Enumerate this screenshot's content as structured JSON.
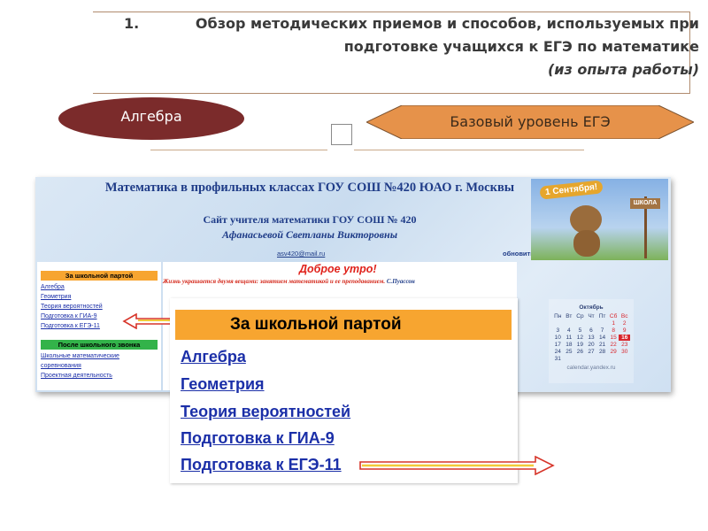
{
  "slide": {
    "title_number": "1.",
    "title_line1": "Обзор методических приемов и способов, используемых при",
    "title_line2": "подготовке учащихся к ЕГЭ по математике",
    "title_line3": "(из опыта работы)",
    "algebra_label": "Алгебра",
    "level_label": "Базовый уровень ЕГЭ",
    "colors": {
      "oval": "#7b2b2b",
      "diamond": "#e6924a",
      "frame_line": "#b08b6e"
    },
    "mid_icon": "square-icon"
  },
  "website": {
    "header_title": "Математика в профильных классах ГОУ СОШ №420 ЮАО г. Москвы",
    "subtitle_line1": "Сайт учителя математики ГОУ СОШ № 420",
    "subtitle_line2": "Афанасьевой Светланы Викторовны",
    "email": "asv420@mail.ru",
    "refresh_link": "обновить страницу",
    "banner_date": "1 Сентября!",
    "banner_sign": "ШКОЛА",
    "sidebar": {
      "section1": "За школьной партой",
      "links1": [
        "Алгебра",
        "Геометрия",
        "Теория вероятностей",
        "Подготовка к ГИА-9",
        "Подготовка к ЕГЭ-11"
      ],
      "section2": "После школьного звонка",
      "links2": [
        "Школьные математические",
        "соревнования",
        "Проектная деятельность"
      ]
    },
    "greeting": "Доброе утро!",
    "quote": "Жизнь украшается двумя вещами: занятием математикой и ее преподаванием.",
    "quote_author": "С.Пуассон",
    "calendar": {
      "month": "Октябрь",
      "weekdays": [
        "Пн",
        "Вт",
        "Ср",
        "Чт",
        "Пт",
        "Сб",
        "Вс"
      ],
      "days": [
        "",
        "",
        "",
        "",
        "",
        "1",
        "2",
        "3",
        "4",
        "5",
        "6",
        "7",
        "8",
        "9",
        "10",
        "11",
        "12",
        "13",
        "14",
        "15",
        "16",
        "17",
        "18",
        "19",
        "20",
        "21",
        "22",
        "23",
        "24",
        "25",
        "26",
        "27",
        "28",
        "29",
        "30",
        "31",
        "",
        "",
        "",
        "",
        "",
        ""
      ],
      "today": "16",
      "footer": "calendar.yandex.ru"
    }
  },
  "overlay": {
    "header": "За школьной партой",
    "links": [
      "Алгебра",
      "Геометрия",
      "Теория вероятностей",
      "Подготовка к ГИА-9",
      "Подготовка к ЕГЭ-11"
    ]
  }
}
